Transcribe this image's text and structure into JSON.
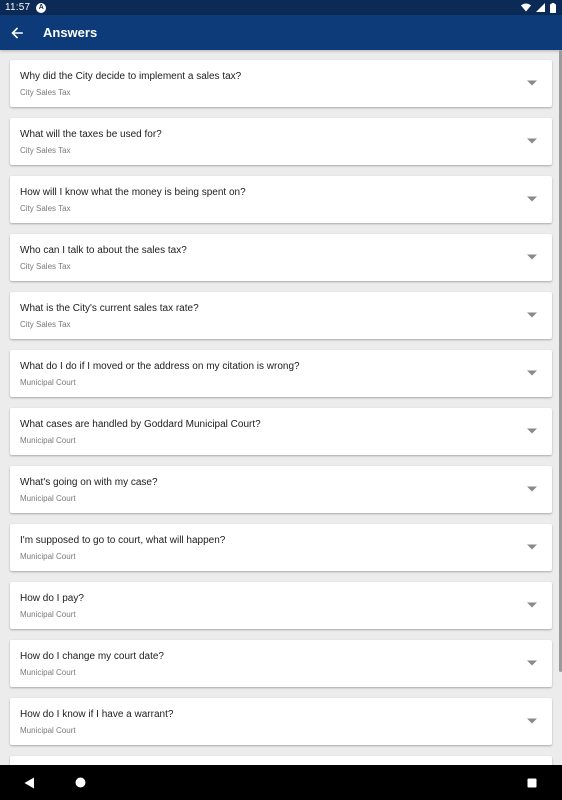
{
  "status_bar": {
    "time": "11:57",
    "notification_letter": "A",
    "icons": [
      "wifi-icon",
      "signal-icon",
      "battery-icon"
    ]
  },
  "app_bar": {
    "title": "Answers",
    "back_icon": "back-arrow-icon"
  },
  "colors": {
    "status_bar": "#0b2a55",
    "app_bar": "#0d3a78",
    "background": "#ececec",
    "card": "#ffffff",
    "question_text": "#202020",
    "category_text": "#7a7a7a",
    "chevron": "#8a8a8a"
  },
  "faq": [
    {
      "question": "Why did the City decide to implement a sales tax?",
      "category": "City Sales Tax"
    },
    {
      "question": "What will the taxes be used for?",
      "category": "City Sales Tax"
    },
    {
      "question": "How will I know what the money is being spent on?",
      "category": "City Sales Tax"
    },
    {
      "question": "Who can I talk to about the sales tax?",
      "category": "City Sales Tax"
    },
    {
      "question": "What is the City's current sales tax rate?",
      "category": "City Sales Tax"
    },
    {
      "question": "What do I do if I moved or the address on my citation is wrong?",
      "category": "Municipal Court"
    },
    {
      "question": "What cases are handled by Goddard Municipal Court?",
      "category": "Municipal Court"
    },
    {
      "question": "What's going on with my case?",
      "category": "Municipal Court"
    },
    {
      "question": "I'm supposed to go to court, what will happen?",
      "category": "Municipal Court"
    },
    {
      "question": "How do I pay?",
      "category": "Municipal Court"
    },
    {
      "question": "How do I change my court date?",
      "category": "Municipal Court"
    },
    {
      "question": "How do I know if I have a warrant?",
      "category": "Municipal Court"
    }
  ],
  "nav_bar": {
    "icons": [
      "back-triangle-icon",
      "home-circle-icon",
      "recents-square-icon"
    ]
  }
}
